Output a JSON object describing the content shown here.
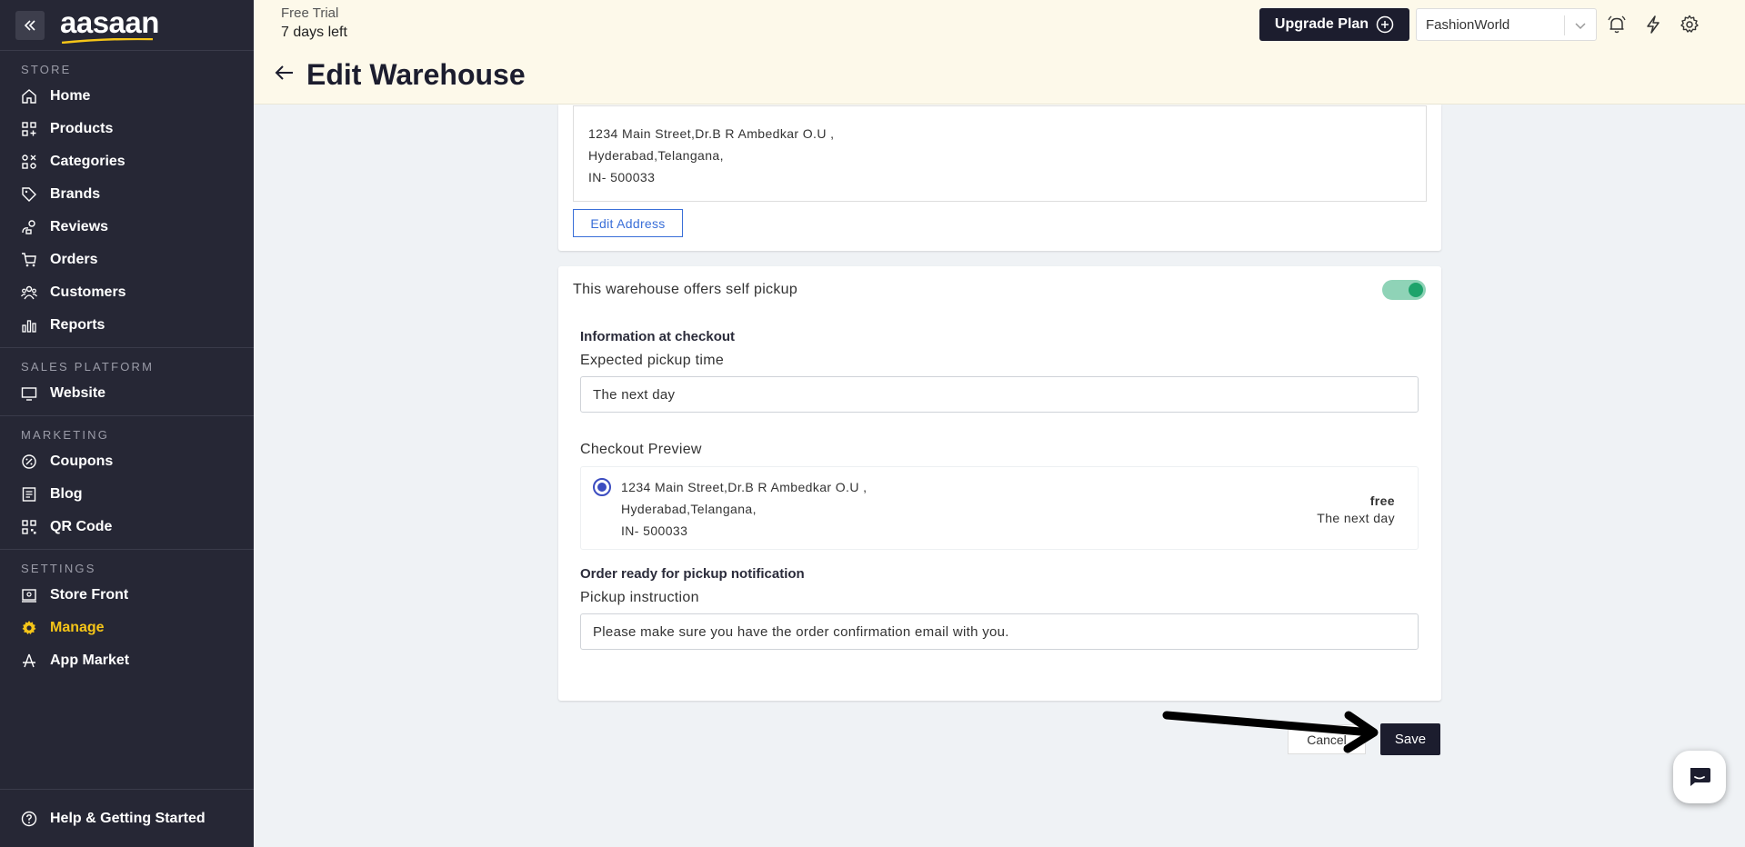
{
  "brand": {
    "logo_text": "aasaan"
  },
  "sidebar": {
    "sections": [
      {
        "heading": "STORE",
        "items": [
          {
            "label": "Home",
            "icon": "home-icon"
          },
          {
            "label": "Products",
            "icon": "products-icon"
          },
          {
            "label": "Categories",
            "icon": "categories-icon"
          },
          {
            "label": "Brands",
            "icon": "tag-icon"
          },
          {
            "label": "Reviews",
            "icon": "reviews-icon"
          },
          {
            "label": "Orders",
            "icon": "cart-icon"
          },
          {
            "label": "Customers",
            "icon": "customers-icon"
          },
          {
            "label": "Reports",
            "icon": "bar-chart-icon"
          }
        ]
      },
      {
        "heading": "SALES PLATFORM",
        "items": [
          {
            "label": "Website",
            "icon": "monitor-icon"
          }
        ]
      },
      {
        "heading": "MARKETING",
        "items": [
          {
            "label": "Coupons",
            "icon": "coupon-icon"
          },
          {
            "label": "Blog",
            "icon": "blog-icon"
          },
          {
            "label": "QR Code",
            "icon": "qr-code-icon"
          }
        ]
      },
      {
        "heading": "SETTINGS",
        "items": [
          {
            "label": "Store Front",
            "icon": "store-front-icon"
          },
          {
            "label": "Manage",
            "icon": "gear-icon",
            "active": true
          },
          {
            "label": "App Market",
            "icon": "app-market-icon"
          }
        ]
      }
    ],
    "help_label": "Help & Getting Started"
  },
  "header": {
    "trial_title": "Free Trial",
    "trial_days": "7 days left",
    "page_title": "Edit Warehouse",
    "upgrade_label": "Upgrade Plan",
    "store_name": "FashionWorld"
  },
  "address": {
    "line1": "1234 Main Street,Dr.B R Ambedkar O.U ,",
    "line2": "Hyderabad,Telangana,",
    "line3": "IN- 500033",
    "edit_label": "Edit Address"
  },
  "pickup": {
    "self_pickup_label": "This warehouse offers self pickup",
    "self_pickup_enabled": true,
    "checkout_info_heading": "Information at checkout",
    "pickup_time_label": "Expected pickup time",
    "pickup_time_value": "The next day",
    "preview_label": "Checkout Preview",
    "preview": {
      "line1": "1234 Main Street,Dr.B R Ambedkar O.U ,",
      "line2": "Hyderabad,Telangana,",
      "line3": "IN- 500033",
      "price": "free",
      "time": "The next day"
    },
    "notification_heading": "Order ready for pickup notification",
    "instruction_label": "Pickup instruction",
    "instruction_value": "Please make sure you have the order confirmation email with you."
  },
  "actions": {
    "cancel_label": "Cancel",
    "save_label": "Save"
  },
  "colors": {
    "sidebar_bg": "#262735",
    "header_bg": "#fdf9ea",
    "accent_yellow": "#f5c518",
    "primary_dark": "#1c1d2e",
    "link_blue": "#3a6fd8",
    "toggle_green": "#1ea36b"
  }
}
